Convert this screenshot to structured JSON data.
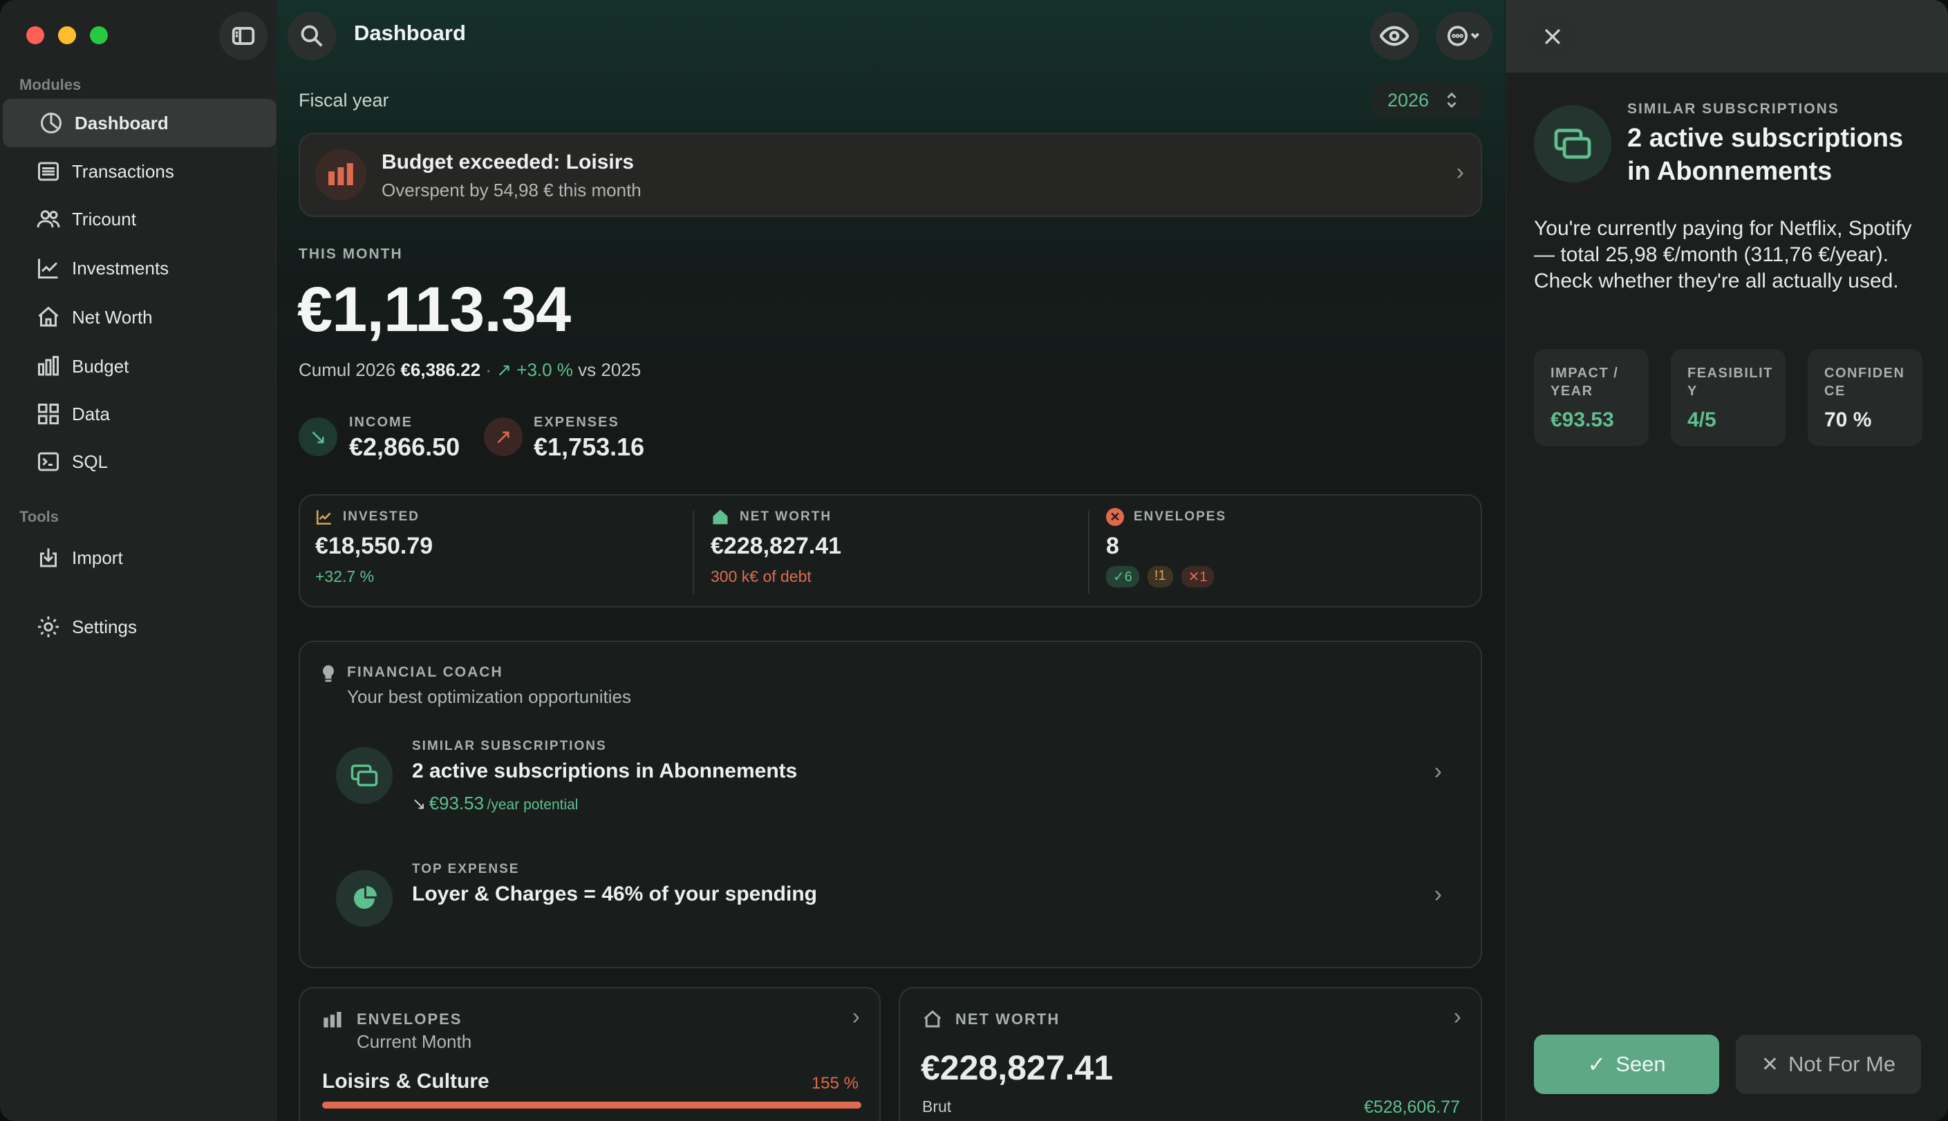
{
  "window": {
    "title": "Dashboard"
  },
  "sidebar": {
    "modules_label": "Modules",
    "items": [
      {
        "label": "Dashboard",
        "icon": "dashboard-gauge-icon"
      },
      {
        "label": "Transactions",
        "icon": "list-icon"
      },
      {
        "label": "Tricount",
        "icon": "people-icon"
      },
      {
        "label": "Investments",
        "icon": "chart-line-icon"
      },
      {
        "label": "Net Worth",
        "icon": "house-icon"
      },
      {
        "label": "Budget",
        "icon": "bars-icon"
      },
      {
        "label": "Data",
        "icon": "grid-icon"
      },
      {
        "label": "SQL",
        "icon": "terminal-icon"
      }
    ],
    "tools_label": "Tools",
    "tools": [
      {
        "label": "Import",
        "icon": "import-icon"
      }
    ],
    "settings": {
      "label": "Settings",
      "icon": "gear-icon"
    }
  },
  "header": {
    "fiscal_label": "Fiscal year",
    "fiscal_value": "2026"
  },
  "alert": {
    "title": "Budget exceeded: Loisirs",
    "subtitle": "Overspent by 54,98 € this month"
  },
  "month": {
    "label": "THIS MONTH",
    "amount": "€1,113.34",
    "cumul_label": "Cumul 2026",
    "cumul_value": "€6,386.22",
    "sep": "·",
    "change": "↗ +3.0 %",
    "vs": "vs 2025",
    "income_label": "INCOME",
    "income_value": "€2,866.50",
    "expenses_label": "EXPENSES",
    "expenses_value": "€1,753.16"
  },
  "stats": {
    "invested": {
      "label": "INVESTED",
      "value": "€18,550.79",
      "sub": "+32.7 %"
    },
    "networth": {
      "label": "NET WORTH",
      "value": "€228,827.41",
      "sub": "300 k€ of debt"
    },
    "envelopes": {
      "label": "ENVELOPES",
      "value": "8",
      "badge_ok": "✓6",
      "badge_warn": "!1",
      "badge_over": "✕1"
    }
  },
  "coach": {
    "label": "FINANCIAL COACH",
    "subtitle": "Your best optimization opportunities",
    "items": [
      {
        "kicker": "SIMILAR SUBSCRIPTIONS",
        "title": "2 active subscriptions in Abonnements",
        "arrow": "↘",
        "amount": "€93.53",
        "potential": "/year potential"
      },
      {
        "kicker": "TOP EXPENSE",
        "title": "Loyer & Charges = 46% of your spending"
      }
    ]
  },
  "envelopes_card": {
    "label": "ENVELOPES",
    "subtitle": "Current Month",
    "item": "Loisirs & Culture",
    "percent": "155 %",
    "fill": 1.0
  },
  "networth_card": {
    "label": "NET WORTH",
    "value": "€228,827.41",
    "brut_label": "Brut",
    "brut_value": "€528,606.77"
  },
  "detail": {
    "kicker": "SIMILAR SUBSCRIPTIONS",
    "title": "2 active subscriptions in Abonnements",
    "body": "You're currently paying for Netflix, Spotify — total 25,98 €/month (311,76 €/year). Check whether they're all actually used.",
    "stats": [
      {
        "label": "IMPACT / YEAR",
        "value": "€93.53",
        "color": "#5fbf8f"
      },
      {
        "label": "FEASIBILITY",
        "value": "4/5",
        "color": "#5fbf8f"
      },
      {
        "label": "CONFIDENCE",
        "value": "70 %",
        "color": "#e9ecea"
      }
    ],
    "seen": "Seen",
    "not_for_me": "Not For Me"
  },
  "colors": {
    "accent_green": "#5fbf8f",
    "danger": "#e06a4f",
    "seen_button": "#5fa886"
  }
}
